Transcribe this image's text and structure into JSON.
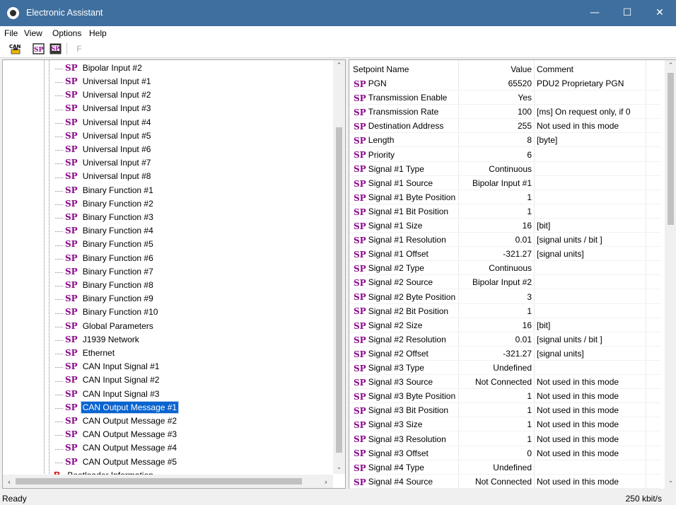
{
  "window": {
    "title": "Electronic Assistant"
  },
  "menu": {
    "file": "File",
    "view": "View",
    "options": "Options",
    "help": "Help"
  },
  "toolbar": {
    "can_label": "CAN",
    "sp_label": "SP",
    "f_label": "F"
  },
  "tree": {
    "items": [
      "Bipolar Input #2",
      "Universal Input #1",
      "Universal Input #2",
      "Universal Input #3",
      "Universal Input #4",
      "Universal Input #5",
      "Universal Input #6",
      "Universal Input #7",
      "Universal Input #8",
      "Binary Function #1",
      "Binary Function #2",
      "Binary Function #3",
      "Binary Function #4",
      "Binary Function #5",
      "Binary Function #6",
      "Binary Function #7",
      "Binary Function #8",
      "Binary Function #9",
      "Binary Function #10",
      "Global Parameters",
      "J1939 Network",
      "Ethernet",
      "CAN Input Signal #1",
      "CAN Input Signal #2",
      "CAN Input Signal #3",
      "CAN Output Message #1",
      "CAN Output Message #2",
      "CAN Output Message #3",
      "CAN Output Message #4",
      "CAN Output Message #5"
    ],
    "selected_index": 25,
    "bootloader": "Bootloader Information",
    "icon_sp": "SP",
    "icon_b": "B"
  },
  "table": {
    "headers": {
      "name": "Setpoint Name",
      "value": "Value",
      "comment": "Comment"
    },
    "icon": "SP",
    "rows": [
      {
        "name": "PGN",
        "value": "65520",
        "comment": "PDU2 Proprietary PGN"
      },
      {
        "name": "Transmission Enable",
        "value": "Yes",
        "comment": ""
      },
      {
        "name": "Transmission Rate",
        "value": "100",
        "comment": "[ms]  On request only, if 0"
      },
      {
        "name": "Destination Address",
        "value": "255",
        "comment": "Not used in this mode"
      },
      {
        "name": "Length",
        "value": "8",
        "comment": "[byte]"
      },
      {
        "name": "Priority",
        "value": "6",
        "comment": ""
      },
      {
        "name": "Signal #1 Type",
        "value": "Continuous",
        "comment": ""
      },
      {
        "name": "Signal #1 Source",
        "value": "Bipolar Input #1",
        "comment": ""
      },
      {
        "name": "Signal #1 Byte Position",
        "value": "1",
        "comment": ""
      },
      {
        "name": "Signal #1 Bit Position",
        "value": "1",
        "comment": ""
      },
      {
        "name": "Signal #1 Size",
        "value": "16",
        "comment": "[bit]"
      },
      {
        "name": "Signal #1 Resolution",
        "value": "0.01",
        "comment": "[signal units / bit ]"
      },
      {
        "name": "Signal #1 Offset",
        "value": "-321.27",
        "comment": "[signal units]"
      },
      {
        "name": "Signal #2 Type",
        "value": "Continuous",
        "comment": ""
      },
      {
        "name": "Signal #2 Source",
        "value": "Bipolar Input #2",
        "comment": ""
      },
      {
        "name": "Signal #2 Byte Position",
        "value": "3",
        "comment": ""
      },
      {
        "name": "Signal #2 Bit Position",
        "value": "1",
        "comment": ""
      },
      {
        "name": "Signal #2 Size",
        "value": "16",
        "comment": "[bit]"
      },
      {
        "name": "Signal #2 Resolution",
        "value": "0.01",
        "comment": "[signal units / bit ]"
      },
      {
        "name": "Signal #2 Offset",
        "value": "-321.27",
        "comment": "[signal units]"
      },
      {
        "name": "Signal #3 Type",
        "value": "Undefined",
        "comment": ""
      },
      {
        "name": "Signal #3 Source",
        "value": "Not Connected",
        "comment": "Not used in this mode"
      },
      {
        "name": "Signal #3 Byte Position",
        "value": "1",
        "comment": "Not used in this mode"
      },
      {
        "name": "Signal #3 Bit Position",
        "value": "1",
        "comment": "Not used in this mode"
      },
      {
        "name": "Signal #3 Size",
        "value": "1",
        "comment": "Not used in this mode"
      },
      {
        "name": "Signal #3 Resolution",
        "value": "1",
        "comment": "Not used in this mode"
      },
      {
        "name": "Signal #3 Offset",
        "value": "0",
        "comment": "Not used in this mode"
      },
      {
        "name": "Signal #4 Type",
        "value": "Undefined",
        "comment": ""
      },
      {
        "name": "Signal #4 Source",
        "value": "Not Connected",
        "comment": "Not used in this mode"
      }
    ]
  },
  "status": {
    "left": "Ready",
    "right": "250 kbit/s"
  },
  "colors": {
    "titlebar": "#3f6f9e",
    "selection": "#0a64d0",
    "sp_icon": "#8b0c8b",
    "b_icon": "#d40000"
  }
}
